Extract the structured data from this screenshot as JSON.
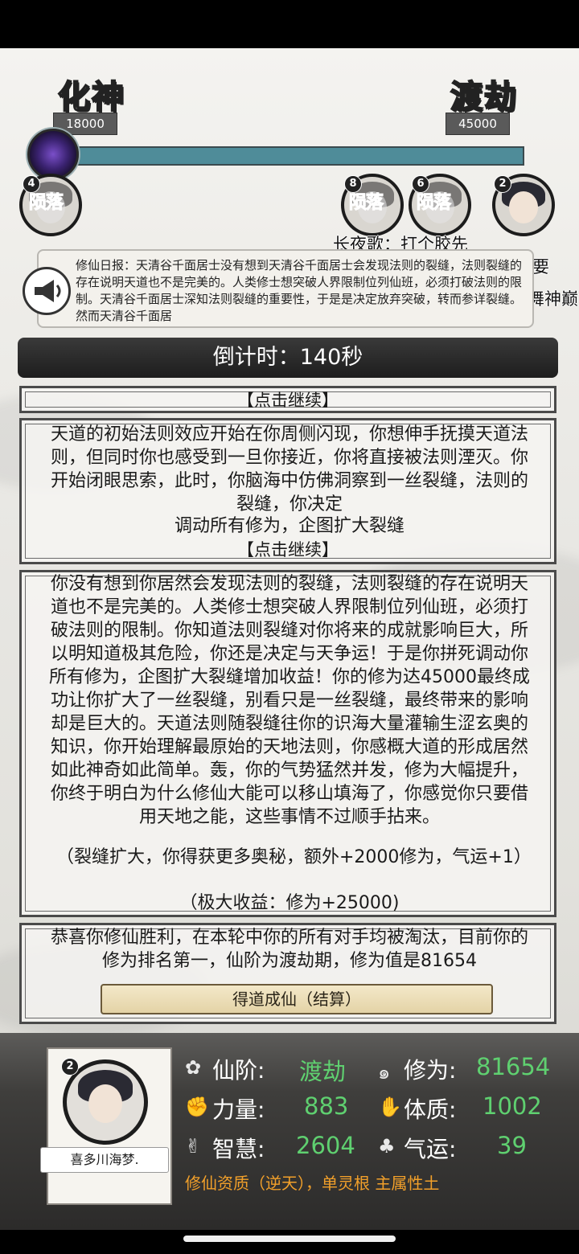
{
  "realms": {
    "current": {
      "name": "化神",
      "value": "18000"
    },
    "next": {
      "name": "渡劫",
      "value": "45000"
    }
  },
  "progress": {
    "fraction": 1.0,
    "color": "#4f8c99"
  },
  "opponents": [
    {
      "badge": "4",
      "status": "陨落"
    },
    {
      "badge": "8",
      "status": "陨落"
    },
    {
      "badge": "6",
      "status": "陨落"
    },
    {
      "badge": "2",
      "status": ""
    }
  ],
  "chat": [
    "长夜歌：打个胶先",
    "太上门宗福老君：余红凯不要",
    "舞神巅"
  ],
  "news": {
    "icon": "megaphone-icon",
    "text": "修仙日报：天清谷千面居士没有想到天清谷千面居士会发现法则的裂缝，法则裂缝的存在说明天道也不是完美的。人类修士想突破人界限制位列仙班，必须打破法则的限制。天清谷千面居士深知法则裂缝的重要性，于是是决定放弃突破，转而参详裂缝。然而天清谷千面居"
  },
  "timer": "倒计时：140秒",
  "continue_label": "【点击继续】",
  "story1": {
    "text": "天道的初始法则效应开始在你周侧闪现，你想伸手抚摸天道法则，但同时你也感受到一旦你接近，你将直接被法则湮灭。你开始闭眼思索，此时，你脑海中仿佛洞察到一丝裂缝，法则的裂缝，你决定",
    "choice": "调动所有修为，企图扩大裂缝"
  },
  "story2": {
    "text": "你没有想到你居然会发现法则的裂缝，法则裂缝的存在说明天道也不是完美的。人类修士想突破人界限制位列仙班，必须打破法则的限制。你知道法则裂缝对你将来的成就影响巨大，所以明知道极其危险，你还是决定与天争运！于是你拼死调动你所有修为，企图扩大裂缝增加收益！你的修为达45000最终成功让你扩大了一丝裂缝，别看只是一丝裂缝，最终带来的影响却是巨大的。天道法则随裂缝往你的识海大量灌输生涩玄奥的知识，你开始理解最原始的天地法则，你感概大道的形成居然如此神奇如此简单。轰，你的气势猛然并发，修为大幅提升，你终于明白为什么修仙大能可以移山填海了，你感觉你只要借用天地之能，这些事情不过顺手拈来。",
    "reward": "（裂缝扩大，你得获更多奥秘，额外+2000修为，气运+1）",
    "gain": "（极大收益：修为+25000)"
  },
  "victory": {
    "text": "恭喜你修仙胜利，在本轮中你的所有对手均被淘汰，目前你的修为排名第一，仙阶为渡劫期，修为值是81654",
    "button": "得道成仙（结算）"
  },
  "player": {
    "badge": "2",
    "name": "喜多川海梦.",
    "stats": {
      "rank_label": "仙阶:",
      "rank": "渡劫",
      "cultivation_label": "修为:",
      "cultivation": "81654",
      "strength_label": "力量:",
      "strength": "883",
      "constitution_label": "体质:",
      "constitution": "1002",
      "wisdom_label": "智慧:",
      "wisdom": "2604",
      "luck_label": "气运:",
      "luck": "39"
    },
    "aptitude": "修仙资质（逆天），单灵根 主属性土"
  }
}
